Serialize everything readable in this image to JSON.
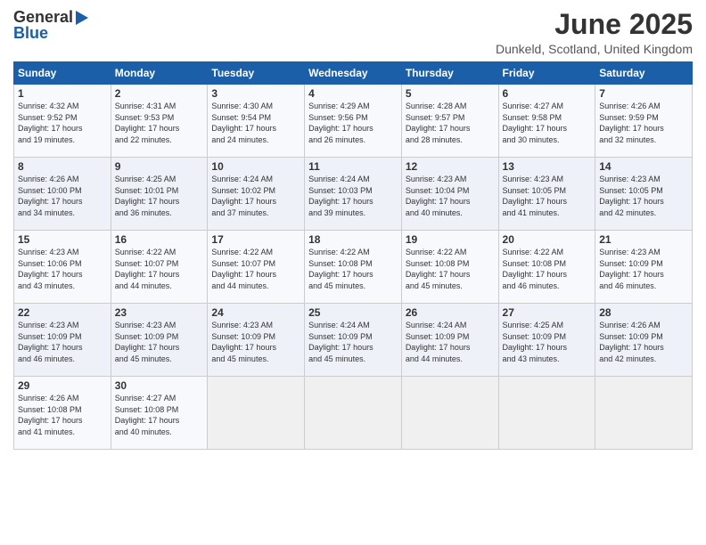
{
  "header": {
    "logo_general": "General",
    "logo_blue": "Blue",
    "month_title": "June 2025",
    "location": "Dunkeld, Scotland, United Kingdom"
  },
  "days_of_week": [
    "Sunday",
    "Monday",
    "Tuesday",
    "Wednesday",
    "Thursday",
    "Friday",
    "Saturday"
  ],
  "weeks": [
    [
      {
        "day": "1",
        "info": "Sunrise: 4:32 AM\nSunset: 9:52 PM\nDaylight: 17 hours\nand 19 minutes."
      },
      {
        "day": "2",
        "info": "Sunrise: 4:31 AM\nSunset: 9:53 PM\nDaylight: 17 hours\nand 22 minutes."
      },
      {
        "day": "3",
        "info": "Sunrise: 4:30 AM\nSunset: 9:54 PM\nDaylight: 17 hours\nand 24 minutes."
      },
      {
        "day": "4",
        "info": "Sunrise: 4:29 AM\nSunset: 9:56 PM\nDaylight: 17 hours\nand 26 minutes."
      },
      {
        "day": "5",
        "info": "Sunrise: 4:28 AM\nSunset: 9:57 PM\nDaylight: 17 hours\nand 28 minutes."
      },
      {
        "day": "6",
        "info": "Sunrise: 4:27 AM\nSunset: 9:58 PM\nDaylight: 17 hours\nand 30 minutes."
      },
      {
        "day": "7",
        "info": "Sunrise: 4:26 AM\nSunset: 9:59 PM\nDaylight: 17 hours\nand 32 minutes."
      }
    ],
    [
      {
        "day": "8",
        "info": "Sunrise: 4:26 AM\nSunset: 10:00 PM\nDaylight: 17 hours\nand 34 minutes."
      },
      {
        "day": "9",
        "info": "Sunrise: 4:25 AM\nSunset: 10:01 PM\nDaylight: 17 hours\nand 36 minutes."
      },
      {
        "day": "10",
        "info": "Sunrise: 4:24 AM\nSunset: 10:02 PM\nDaylight: 17 hours\nand 37 minutes."
      },
      {
        "day": "11",
        "info": "Sunrise: 4:24 AM\nSunset: 10:03 PM\nDaylight: 17 hours\nand 39 minutes."
      },
      {
        "day": "12",
        "info": "Sunrise: 4:23 AM\nSunset: 10:04 PM\nDaylight: 17 hours\nand 40 minutes."
      },
      {
        "day": "13",
        "info": "Sunrise: 4:23 AM\nSunset: 10:05 PM\nDaylight: 17 hours\nand 41 minutes."
      },
      {
        "day": "14",
        "info": "Sunrise: 4:23 AM\nSunset: 10:05 PM\nDaylight: 17 hours\nand 42 minutes."
      }
    ],
    [
      {
        "day": "15",
        "info": "Sunrise: 4:23 AM\nSunset: 10:06 PM\nDaylight: 17 hours\nand 43 minutes."
      },
      {
        "day": "16",
        "info": "Sunrise: 4:22 AM\nSunset: 10:07 PM\nDaylight: 17 hours\nand 44 minutes."
      },
      {
        "day": "17",
        "info": "Sunrise: 4:22 AM\nSunset: 10:07 PM\nDaylight: 17 hours\nand 44 minutes."
      },
      {
        "day": "18",
        "info": "Sunrise: 4:22 AM\nSunset: 10:08 PM\nDaylight: 17 hours\nand 45 minutes."
      },
      {
        "day": "19",
        "info": "Sunrise: 4:22 AM\nSunset: 10:08 PM\nDaylight: 17 hours\nand 45 minutes."
      },
      {
        "day": "20",
        "info": "Sunrise: 4:22 AM\nSunset: 10:08 PM\nDaylight: 17 hours\nand 46 minutes."
      },
      {
        "day": "21",
        "info": "Sunrise: 4:23 AM\nSunset: 10:09 PM\nDaylight: 17 hours\nand 46 minutes."
      }
    ],
    [
      {
        "day": "22",
        "info": "Sunrise: 4:23 AM\nSunset: 10:09 PM\nDaylight: 17 hours\nand 46 minutes."
      },
      {
        "day": "23",
        "info": "Sunrise: 4:23 AM\nSunset: 10:09 PM\nDaylight: 17 hours\nand 45 minutes."
      },
      {
        "day": "24",
        "info": "Sunrise: 4:23 AM\nSunset: 10:09 PM\nDaylight: 17 hours\nand 45 minutes."
      },
      {
        "day": "25",
        "info": "Sunrise: 4:24 AM\nSunset: 10:09 PM\nDaylight: 17 hours\nand 45 minutes."
      },
      {
        "day": "26",
        "info": "Sunrise: 4:24 AM\nSunset: 10:09 PM\nDaylight: 17 hours\nand 44 minutes."
      },
      {
        "day": "27",
        "info": "Sunrise: 4:25 AM\nSunset: 10:09 PM\nDaylight: 17 hours\nand 43 minutes."
      },
      {
        "day": "28",
        "info": "Sunrise: 4:26 AM\nSunset: 10:09 PM\nDaylight: 17 hours\nand 42 minutes."
      }
    ],
    [
      {
        "day": "29",
        "info": "Sunrise: 4:26 AM\nSunset: 10:08 PM\nDaylight: 17 hours\nand 41 minutes."
      },
      {
        "day": "30",
        "info": "Sunrise: 4:27 AM\nSunset: 10:08 PM\nDaylight: 17 hours\nand 40 minutes."
      },
      {
        "day": "",
        "info": ""
      },
      {
        "day": "",
        "info": ""
      },
      {
        "day": "",
        "info": ""
      },
      {
        "day": "",
        "info": ""
      },
      {
        "day": "",
        "info": ""
      }
    ]
  ]
}
